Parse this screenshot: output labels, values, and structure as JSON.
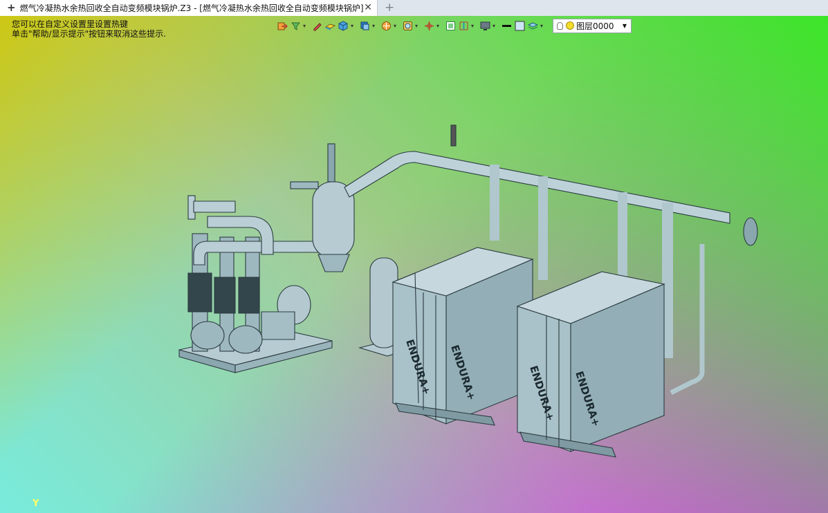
{
  "tab": {
    "title": "燃气冷凝热水余热回收全自动变频模块锅炉.Z3 - [燃气冷凝热水余热回收全自动变频模块锅炉]",
    "close_icon": "close-icon",
    "new_tab_icon": "plus-icon"
  },
  "hint": {
    "line1": "您可以在自定义设置里设置热键",
    "line2": "单击\"帮助/显示提示\"按钮来取消这些提示."
  },
  "toolbar": {
    "layer_value": "图层0000"
  },
  "model": {
    "boiler_label_1": "ENDURA+",
    "boiler_label_2": "ENDURA+",
    "boiler_label_3": "ENDURA+",
    "boiler_label_4": "ENDURA+"
  },
  "axis": {
    "y_label": "Y"
  },
  "colors": {
    "equipment": "#aac4cc",
    "outline": "#2a3a40"
  }
}
